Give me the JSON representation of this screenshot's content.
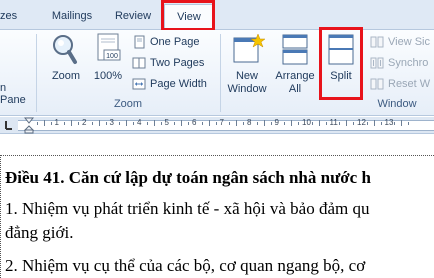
{
  "tabs": [
    {
      "label": "zes"
    },
    {
      "label": "Mailings"
    },
    {
      "label": "Review"
    },
    {
      "label": "View"
    }
  ],
  "ribbon": {
    "nav_pane_label": "n Pane",
    "zoom_group": {
      "label": "Zoom",
      "zoom_label": "Zoom",
      "hundred_label": "100%",
      "hundred_icon_text": "100",
      "one_page_label": "One Page",
      "two_pages_label": "Two Pages",
      "page_width_label": "Page Width"
    },
    "window_group": {
      "label": "Window",
      "new_window_label_1": "New",
      "new_window_label_2": "Window",
      "arrange_all_label_1": "Arrange",
      "arrange_all_label_2": "All",
      "split_label": "Split",
      "view_side_label": "View Sic",
      "synchronous_label": "Synchro",
      "reset_window_label": "Reset W"
    }
  },
  "ruler": {
    "numbers": [
      "1",
      "2",
      "3",
      "4",
      "5",
      "6",
      "7",
      "8",
      "9",
      "10",
      "11",
      "12",
      "13"
    ]
  },
  "document": {
    "heading": "Điều 41. Căn cứ lập dự toán ngân sách nhà nước h",
    "para1_line1": "1. Nhiệm vụ phát triển kinh tế - xã hội và bảo đảm qu",
    "para1_line2": "đẳng giới.",
    "para2_line1": "2. Nhiệm vụ cụ thể của các bộ, cơ quan ngang bộ, cơ"
  },
  "colors": {
    "highlight": "#e8131b",
    "ribbon_bg": "#e6eef8",
    "text": "#1e395b"
  }
}
